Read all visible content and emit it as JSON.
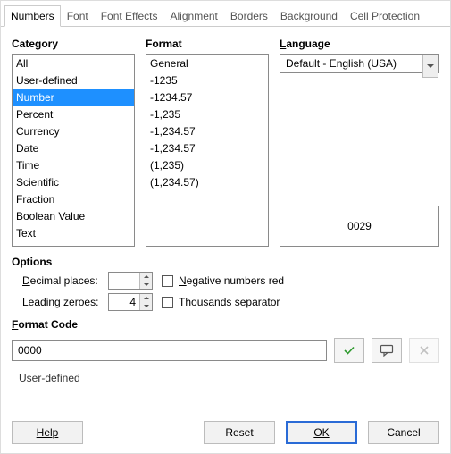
{
  "tabs": [
    "Numbers",
    "Font",
    "Font Effects",
    "Alignment",
    "Borders",
    "Background",
    "Cell Protection"
  ],
  "active_tab_index": 0,
  "labels": {
    "category": "Category",
    "format": "Format",
    "language": "Language",
    "options": "Options",
    "decimal_places": "Decimal places:",
    "leading_zeroes": "Leading zeroes:",
    "negative_red": "Negative numbers red",
    "thousands_sep": "Thousands separator",
    "format_code": "Format Code"
  },
  "category_items": [
    "All",
    "User-defined",
    "Number",
    "Percent",
    "Currency",
    "Date",
    "Time",
    "Scientific",
    "Fraction",
    "Boolean Value",
    "Text"
  ],
  "category_selected_index": 2,
  "format_items": [
    "General",
    "-1235",
    "-1234.57",
    "-1,235",
    "-1,234.57",
    "-1,234.57",
    "(1,235)",
    "(1,234.57)"
  ],
  "format_selected_index": -1,
  "language": {
    "value": "Default - English (USA)"
  },
  "preview": "0029",
  "options": {
    "decimal_places": "",
    "leading_zeroes": "4",
    "negative_red_checked": false,
    "thousands_sep_checked": false
  },
  "format_code": {
    "value": "0000"
  },
  "status_text": "User-defined",
  "buttons": {
    "help": "Help",
    "reset": "Reset",
    "ok": "OK",
    "cancel": "Cancel"
  },
  "icons": {
    "accept": "check",
    "comment": "note",
    "delete": "x"
  }
}
